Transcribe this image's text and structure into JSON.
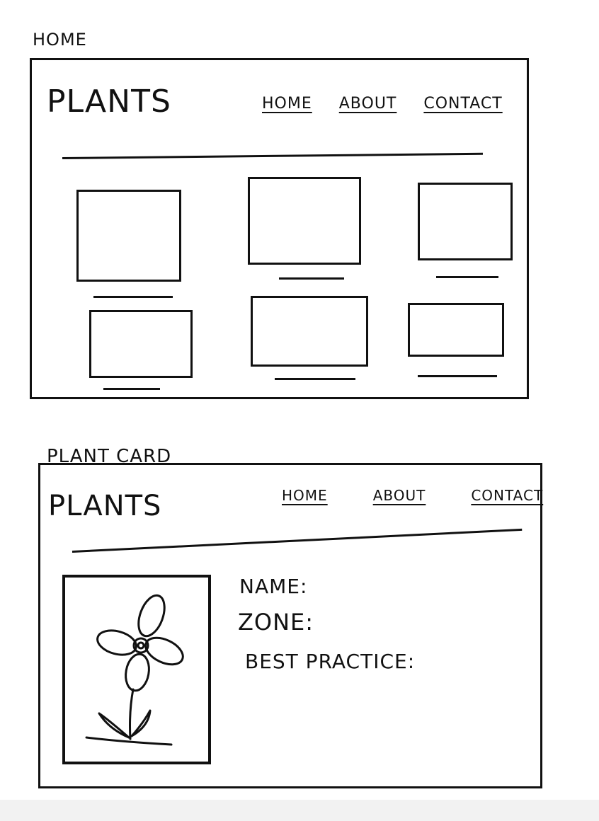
{
  "home_section": {
    "label": "HOME",
    "brand": "PLANTS",
    "nav": [
      "HOME",
      "ABOUT",
      "CONTACT"
    ]
  },
  "plant_card_section": {
    "label": "PLANT CARD",
    "brand": "PLANTS",
    "nav": [
      "HOME",
      "ABOUT",
      "CONTACT"
    ],
    "fields": [
      "NAME:",
      "ZONE:",
      "BEST PRACTICE:"
    ]
  },
  "icons": [
    "flower-icon"
  ]
}
